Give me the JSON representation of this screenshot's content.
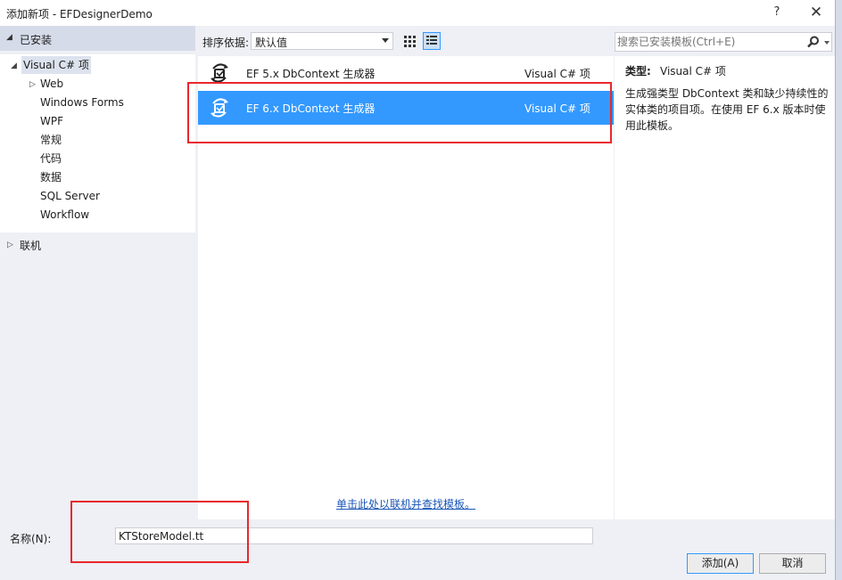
{
  "window": {
    "title": "添加新项 - EFDesignerDemo",
    "help_label": "?",
    "close_label": "✕"
  },
  "left": {
    "installed_label": "已安装",
    "tree": [
      {
        "label": "Visual C# 项",
        "selected": true
      },
      {
        "label": "Web"
      },
      {
        "label": "Windows Forms"
      },
      {
        "label": "WPF"
      },
      {
        "label": "常规"
      },
      {
        "label": "代码"
      },
      {
        "label": "数据"
      },
      {
        "label": "SQL Server"
      },
      {
        "label": "Workflow"
      }
    ],
    "online_label": "联机"
  },
  "toolbar": {
    "sort_label": "排序依据:",
    "sort_value": "默认值"
  },
  "search": {
    "placeholder": "搜索已安装模板(Ctrl+E)"
  },
  "templates": [
    {
      "name": "EF 5.x DbContext 生成器",
      "lang": "Visual C# 项",
      "selected": false
    },
    {
      "name": "EF 6.x DbContext 生成器",
      "lang": "Visual C# 项",
      "selected": true
    }
  ],
  "online_link": "单击此处以联机并查找模板。",
  "details": {
    "type_label": "类型:",
    "type_value": "Visual C# 项",
    "description": "生成强类型 DbContext 类和缺少持续性的实体类的项目项。在使用 EF 6.x 版本时使用此模板。"
  },
  "bottom": {
    "name_label": "名称(N):",
    "name_value": "KTStoreModel.tt",
    "add_label": "添加(A)",
    "cancel_label": "取消"
  },
  "colors": {
    "accent": "#3399ff",
    "highlight_box": "#e8282d",
    "panel_bg": "#eef0f5"
  }
}
